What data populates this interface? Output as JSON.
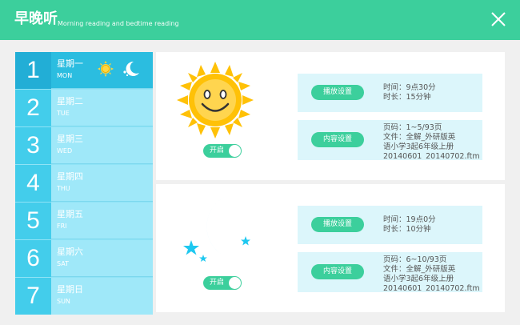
{
  "header": {
    "title": "早晚听",
    "subtitle": "Morning reading and bedtime reading"
  },
  "days": [
    {
      "num": "1",
      "cn": "星期一",
      "en": "MON",
      "active": true
    },
    {
      "num": "2",
      "cn": "星期二",
      "en": "TUE",
      "active": false
    },
    {
      "num": "3",
      "cn": "星期三",
      "en": "WED",
      "active": false
    },
    {
      "num": "4",
      "cn": "星期四",
      "en": "THU",
      "active": false
    },
    {
      "num": "5",
      "cn": "星期五",
      "en": "FRI",
      "active": false
    },
    {
      "num": "6",
      "cn": "星期六",
      "en": "SAT",
      "active": false
    },
    {
      "num": "7",
      "cn": "星期日",
      "en": "SUN",
      "active": false
    }
  ],
  "morning": {
    "toggle_label": "开启",
    "play_btn": "播放设置",
    "time": "时间：9点30分",
    "duration": "时长：15分钟",
    "content_btn": "内容设置",
    "pages": "页码：1~5/93页",
    "file1": "文件：全解_外研版英",
    "file2": "语小学3起6年级上册",
    "file3": "20140601_20140702.ftm"
  },
  "evening": {
    "toggle_label": "开启",
    "play_btn": "播放设置",
    "time": "时间：19点0分",
    "duration": "时长：10分钟",
    "content_btn": "内容设置",
    "pages": "页码：6~10/93页",
    "file1": "文件：全解_外研版英",
    "file2": "语小学3起6年级上册",
    "file3": "20140601_20140702.ftm"
  },
  "colors": {
    "accent": "#3ccf9c",
    "sun": "#ffc107",
    "moon": "#1ec8f0"
  }
}
